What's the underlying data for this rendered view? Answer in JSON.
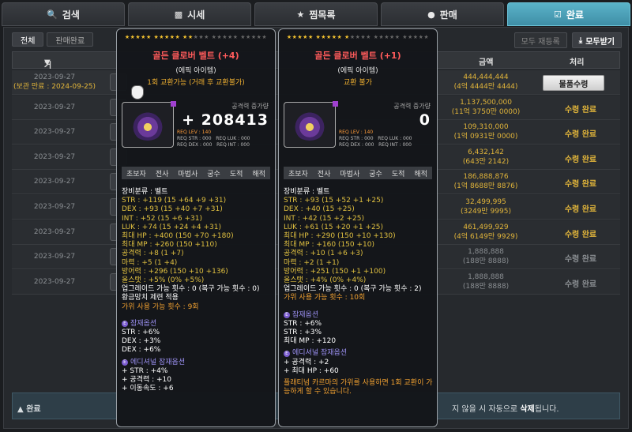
{
  "tabs": [
    {
      "label": "검색",
      "icon": "search-icon"
    },
    {
      "label": "시세",
      "icon": "chart-icon"
    },
    {
      "label": "찜목록",
      "icon": "star-icon"
    },
    {
      "label": "판매",
      "icon": "coin-icon"
    },
    {
      "label": "완료",
      "icon": "check-icon"
    }
  ],
  "filters": {
    "all": "전체",
    "sold": "판매완료"
  },
  "buttons": {
    "reregister": "모두 재등록",
    "receive_all": "모두받기"
  },
  "columns": {
    "date": "거래날짜",
    "price": "금액",
    "process": "처리"
  },
  "rows": [
    {
      "date": "2023-09-27",
      "expire": "(보관 만료 : 2024-09-25)",
      "price": "444,444,444",
      "price_sub": "(4억 4444만 4444)",
      "status": "물품수령",
      "button": true
    },
    {
      "date": "2023-09-27",
      "price": "1,137,500,000",
      "price_sub": "(11억 3750만 0000)",
      "status": "수령 완료"
    },
    {
      "date": "2023-09-27",
      "price": "109,310,000",
      "price_sub": "(1억 0931만 0000)",
      "status": "수령 완료"
    },
    {
      "date": "2023-09-27",
      "price": "6,432,142",
      "price_sub": "(643만 2142)",
      "status": "수령 완료"
    },
    {
      "date": "2023-09-27",
      "price": "186,888,876",
      "price_sub": "(1억 8688만 8876)",
      "status": "수령 완료"
    },
    {
      "date": "2023-09-27",
      "price": "32,499,995",
      "price_sub": "(3249만 9995)",
      "status": "수령 완료"
    },
    {
      "date": "2023-09-27",
      "price": "461,499,929",
      "price_sub": "(4억 6149만 9929)",
      "status": "수령 완료"
    },
    {
      "date": "2023-09-27",
      "price": "1,888,888",
      "price_sub": "(188만 8888)",
      "status": "수령 완료",
      "grey": true
    },
    {
      "date": "2023-09-27",
      "price": "1,888,888",
      "price_sub": "(188만 8888)",
      "status": "수령 완료",
      "grey": true
    }
  ],
  "notice": {
    "left": "완료",
    "right": "지 않을 시 자동으로 ",
    "bold": "삭제",
    "end": "됩니다."
  },
  "tooltip1": {
    "stars_on": "★★★★★ ★★★★★ ★★",
    "stars_off": "★★★ ★★★★★ ★★★★★",
    "name": "골든 클로버 벨트 (+4)",
    "grade": "(에픽 아이템)",
    "trade": "1회 교환가능 (거래 후 교환불가)",
    "atk_label": "공격력 증가량",
    "atk": "+ 208413",
    "req_lv": "REQ LEV : 140",
    "req": "REQ STR : 000   REQ LUK : 000\nREQ DEX : 000   REQ INT : 000",
    "jobs": [
      "초보자",
      "전사",
      "마법사",
      "궁수",
      "도적",
      "해적"
    ],
    "lines": [
      {
        "t": "장비분류 : 벨트",
        "c": ""
      },
      {
        "t": "STR : +119 (15 +64 +9 +31)",
        "c": "y"
      },
      {
        "t": "DEX : +93 (15 +40 +7 +31)",
        "c": "y"
      },
      {
        "t": "INT : +52 (15 +6 +31)",
        "c": "y"
      },
      {
        "t": "LUK : +74 (15 +24 +4 +31)",
        "c": "y"
      },
      {
        "t": "최대 HP : +400 (150 +70 +180)",
        "c": "y"
      },
      {
        "t": "최대 MP : +260 (150 +110)",
        "c": "y"
      },
      {
        "t": "공격력 : +8 (1 +7)",
        "c": "y"
      },
      {
        "t": "마력 : +5 (1 +4)",
        "c": "y"
      },
      {
        "t": "방어력 : +296 (150 +10 +136)",
        "c": "y"
      },
      {
        "t": "올스탯 : +5% (0% +5%)",
        "c": "y"
      },
      {
        "t": "업그레이드 가능 횟수 : 0 (복구 가능 횟수 : 0)",
        "c": ""
      },
      {
        "t": "황금망치 제련 적용",
        "c": ""
      },
      {
        "t": "가위 사용 가능 횟수 : 9회",
        "c": "or"
      }
    ],
    "pot_title": "잠재옵션",
    "pot": [
      "STR : +6%",
      "DEX : +3%",
      "DEX : +6%"
    ],
    "add_title": "에디셔널 잠재옵션",
    "add": [
      "+ STR : +4%",
      "+ 공격력 : +10",
      "+ 이동속도 : +6"
    ]
  },
  "tooltip2": {
    "stars_on": "★★★★★ ★★★★★ ★",
    "stars_off": "★★★★ ★★★★★ ★★★★★",
    "name": "골든 클로버 벨트 (+1)",
    "grade": "(에픽 아이템)",
    "trade": "교환 불가",
    "atk_label": "공격력 증가량",
    "atk": "0",
    "req_lv": "REQ LEV : 140",
    "req": "REQ STR : 000   REQ LUK : 000\nREQ DEX : 000   REQ INT : 000",
    "jobs": [
      "초보자",
      "전사",
      "마법사",
      "궁수",
      "도적",
      "해적"
    ],
    "lines": [
      {
        "t": "장비분류 : 벨트",
        "c": ""
      },
      {
        "t": "STR : +93 (15 +52 +1 +25)",
        "c": "y"
      },
      {
        "t": "DEX : +40 (15 +25)",
        "c": "y"
      },
      {
        "t": "INT : +42 (15 +2 +25)",
        "c": "y"
      },
      {
        "t": "LUK : +61 (15 +20 +1 +25)",
        "c": "y"
      },
      {
        "t": "최대 HP : +290 (150 +10 +130)",
        "c": "y"
      },
      {
        "t": "최대 MP : +160 (150 +10)",
        "c": "y"
      },
      {
        "t": "공격력 : +10 (1 +6 +3)",
        "c": "y"
      },
      {
        "t": "마력 : +2 (1 +1)",
        "c": "y"
      },
      {
        "t": "방어력 : +251 (150 +1 +100)",
        "c": "y"
      },
      {
        "t": "올스탯 : +4% (0% +4%)",
        "c": "y"
      },
      {
        "t": "업그레이드 가능 횟수 : 0 (복구 가능 횟수 : 2)",
        "c": ""
      },
      {
        "t": "가위 사용 가능 횟수 : 10회",
        "c": "or"
      }
    ],
    "pot_title": "잠재옵션",
    "pot": [
      "STR : +6%",
      "STR : +3%",
      "최대 MP : +120"
    ],
    "add_title": "에디셔널 잠재옵션",
    "add": [
      "+ 공격력 : +2",
      "+ 최대 HP : +60"
    ],
    "foot": "플래티넘 카르마의 가위를 사용하면 1회 교환이 가능하게 할 수 있습니다."
  }
}
